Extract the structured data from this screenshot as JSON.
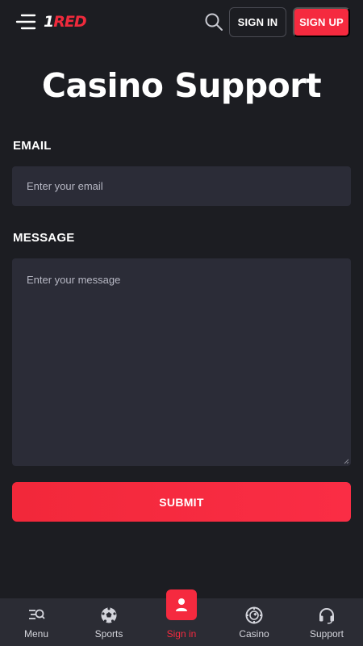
{
  "header": {
    "logo_text": "1RED",
    "signin_label": "SIGN IN",
    "signup_label": "SIGN UP",
    "accent_color": "#f52a3f"
  },
  "page": {
    "title": "Casino Support"
  },
  "form": {
    "email_label": "EMAIL",
    "email_placeholder": "Enter your email",
    "email_value": "",
    "message_label": "MESSAGE",
    "message_placeholder": "Enter your message",
    "message_value": "",
    "submit_label": "SUBMIT"
  },
  "bottom_nav": {
    "items": [
      {
        "label": "Menu",
        "icon": "menu-search-icon",
        "active": false
      },
      {
        "label": "Sports",
        "icon": "soccer-ball-icon",
        "active": false
      },
      {
        "label": "Sign in",
        "icon": "user-icon",
        "active": true
      },
      {
        "label": "Casino",
        "icon": "casino-chip-icon",
        "active": false
      },
      {
        "label": "Support",
        "icon": "headset-icon",
        "active": false
      }
    ]
  }
}
